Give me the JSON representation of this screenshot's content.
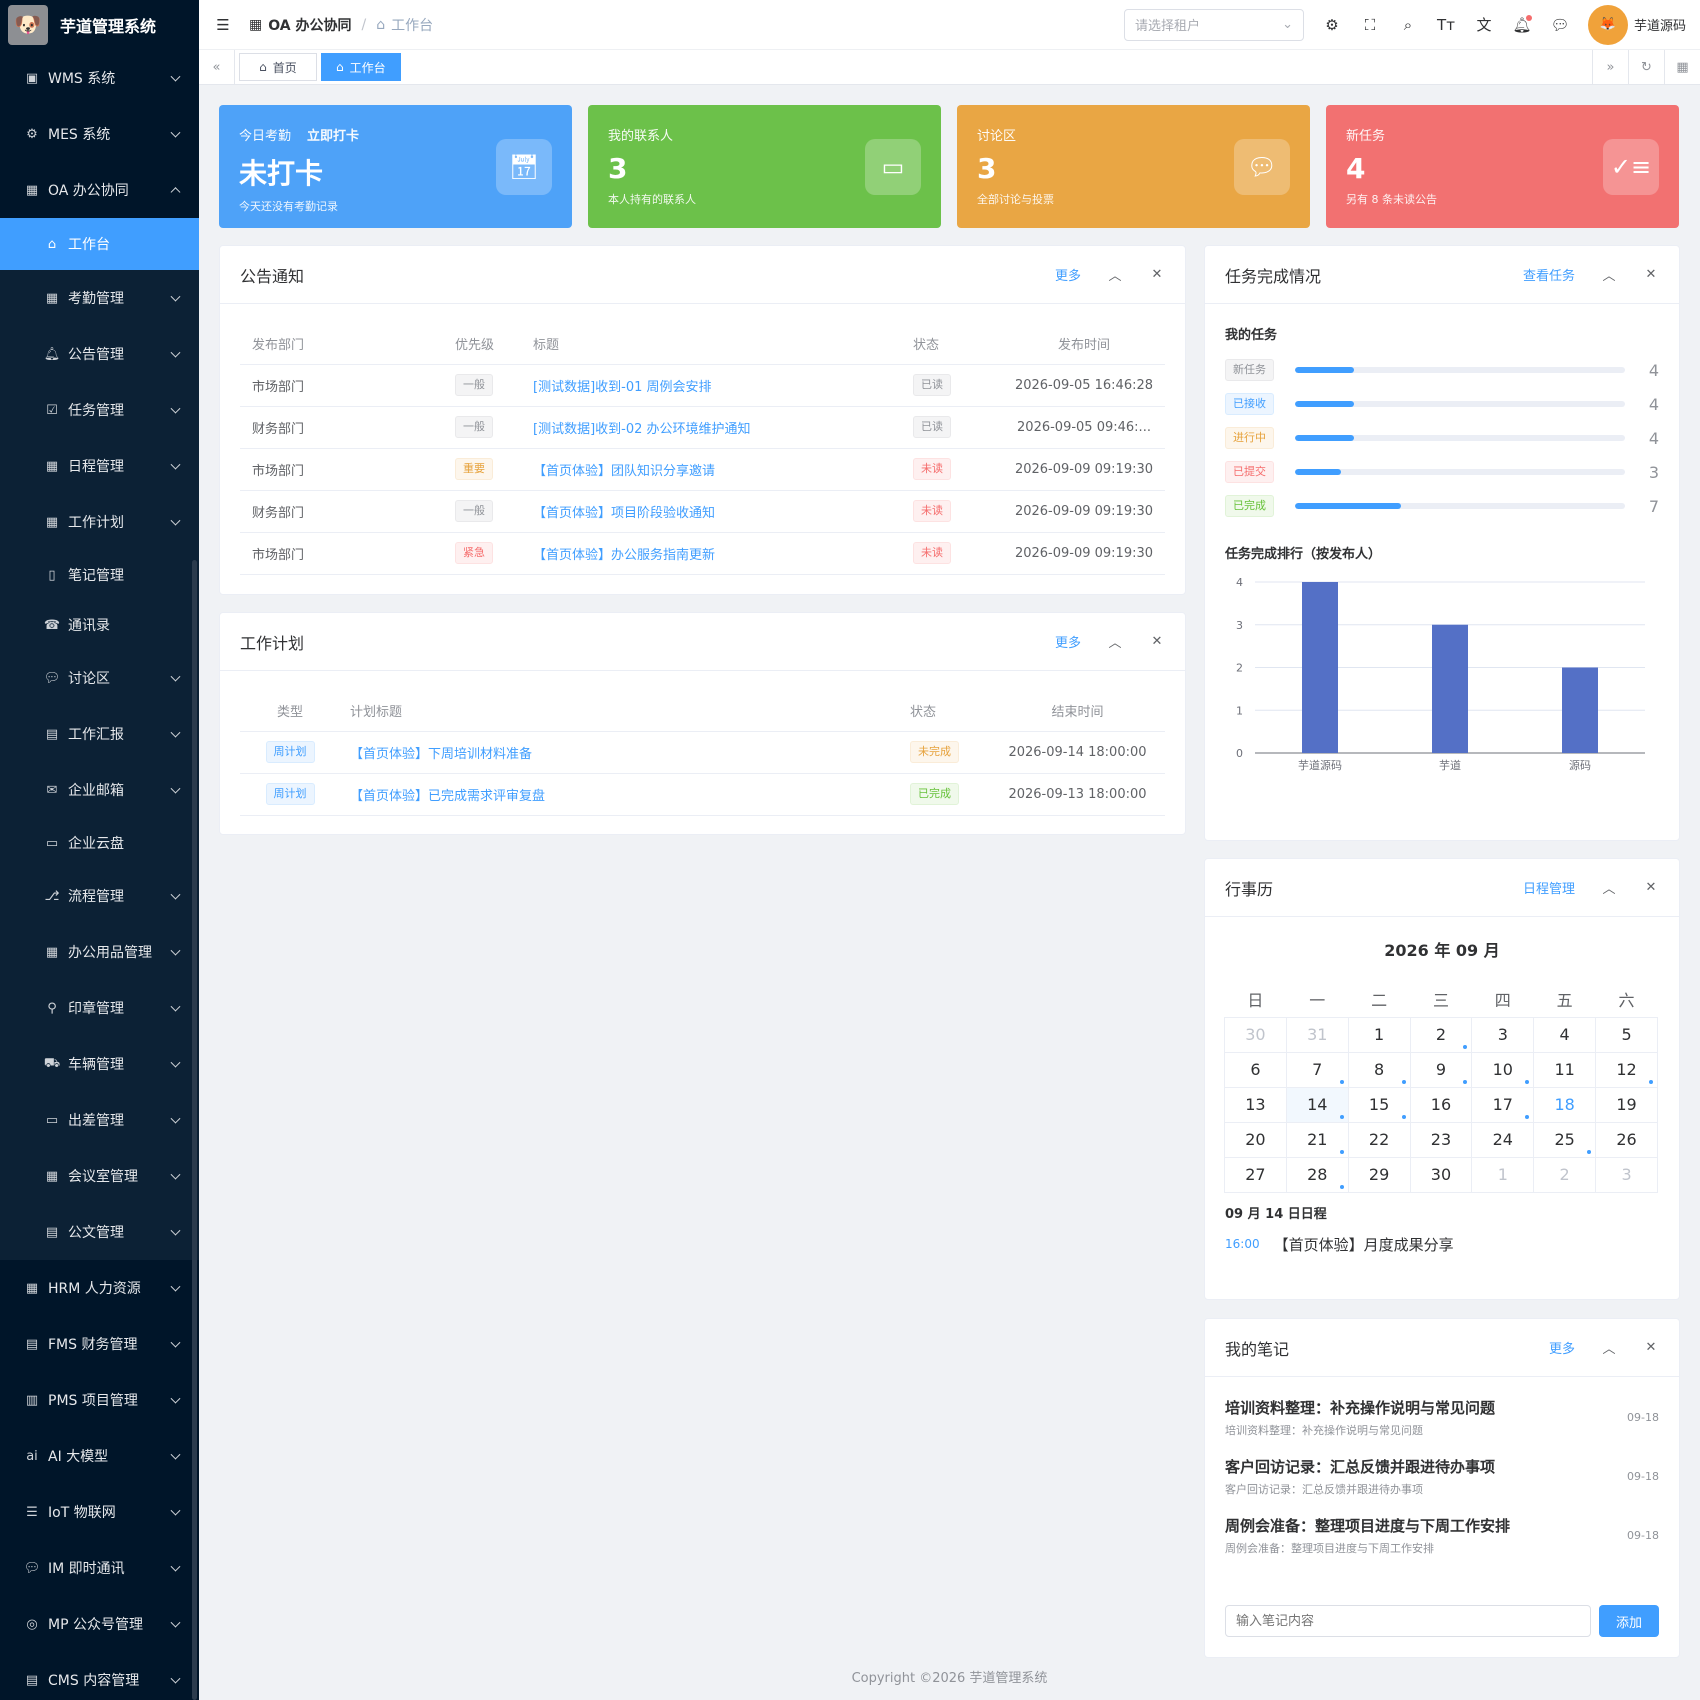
{
  "app": {
    "title": "芋道管理系统",
    "logo": "dog"
  },
  "sidebar": {
    "top": [
      {
        "label": "WMS 系统",
        "icon": "box-icon"
      },
      {
        "label": "MES 系统",
        "icon": "gear-icon"
      },
      {
        "label": "OA 办公协同",
        "icon": "building-icon"
      }
    ],
    "oa_sub": [
      {
        "label": "工作台"
      },
      {
        "label": "考勤管理"
      },
      {
        "label": "公告管理"
      },
      {
        "label": "任务管理"
      },
      {
        "label": "日程管理"
      },
      {
        "label": "工作计划"
      },
      {
        "label": "笔记管理"
      },
      {
        "label": "通讯录"
      },
      {
        "label": "讨论区"
      },
      {
        "label": "工作汇报"
      },
      {
        "label": "企业邮箱"
      },
      {
        "label": "企业云盘"
      },
      {
        "label": "流程管理"
      },
      {
        "label": "办公用品管理"
      },
      {
        "label": "印章管理"
      },
      {
        "label": "车辆管理"
      },
      {
        "label": "出差管理"
      },
      {
        "label": "会议室管理"
      },
      {
        "label": "公文管理"
      }
    ],
    "bottom": [
      {
        "label": "HRM 人力资源"
      },
      {
        "label": "FMS 财务管理"
      },
      {
        "label": "PMS 项目管理"
      },
      {
        "label": "AI 大模型"
      },
      {
        "label": "IoT 物联网"
      },
      {
        "label": "IM 即时通讯"
      },
      {
        "label": "MP 公众号管理"
      },
      {
        "label": "CMS 内容管理"
      }
    ]
  },
  "header": {
    "crumb1": "OA 办公协同",
    "crumb2": "工作台",
    "tenant_placeholder": "请选择租户",
    "username": "芋道源码"
  },
  "tags": {
    "home": "首页",
    "workbench": "工作台"
  },
  "stats": [
    {
      "label": "今日考勤",
      "action": "立即打卡",
      "value": "未打卡",
      "desc": "今天还没有考勤记录",
      "color": "#4ea2f8"
    },
    {
      "label": "我的联系人",
      "value": "3",
      "desc": "本人持有的联系人",
      "color": "#6cc14a"
    },
    {
      "label": "讨论区",
      "value": "3",
      "desc": "全部讨论与投票",
      "color": "#e9a644"
    },
    {
      "label": "新任务",
      "value": "4",
      "desc": "另有 8 条未读公告",
      "color": "#f27171"
    }
  ],
  "notice": {
    "title": "公告通知",
    "more": "更多",
    "columns": [
      "发布部门",
      "优先级",
      "标题",
      "状态",
      "发布时间"
    ],
    "rows": [
      {
        "dept": "市场部门",
        "priority": "一般",
        "title": "[测试数据]收到-01 周例会安排",
        "status": "已读",
        "time": "2026-09-05 16:46:28"
      },
      {
        "dept": "财务部门",
        "priority": "一般",
        "title": "[测试数据]收到-02 办公环境维护通知",
        "status": "已读",
        "time": "2026-09-05 09:46:..."
      },
      {
        "dept": "市场部门",
        "priority": "重要",
        "title": "【首页体验】团队知识分享邀请",
        "status": "未读",
        "time": "2026-09-09 09:19:30"
      },
      {
        "dept": "财务部门",
        "priority": "一般",
        "title": "【首页体验】项目阶段验收通知",
        "status": "未读",
        "time": "2026-09-09 09:19:30"
      },
      {
        "dept": "市场部门",
        "priority": "紧急",
        "title": "【首页体验】办公服务指南更新",
        "status": "未读",
        "time": "2026-09-09 09:19:30"
      }
    ]
  },
  "plan": {
    "title": "工作计划",
    "more": "更多",
    "columns": [
      "类型",
      "计划标题",
      "状态",
      "结束时间"
    ],
    "rows": [
      {
        "type": "周计划",
        "title": "【首页体验】下周培训材料准备",
        "status": "未完成",
        "time": "2026-09-14 18:00:00"
      },
      {
        "type": "周计划",
        "title": "【首页体验】已完成需求评审复盘",
        "status": "已完成",
        "time": "2026-09-13 18:00:00"
      }
    ]
  },
  "tasks": {
    "title": "任务完成情况",
    "more": "查看任务",
    "my_tasks": "我的任务",
    "progress": [
      {
        "label": "新任务",
        "count": "4",
        "fraction": 0.18
      },
      {
        "label": "已接收",
        "count": "4",
        "fraction": 0.18
      },
      {
        "label": "进行中",
        "count": "4",
        "fraction": 0.18
      },
      {
        "label": "已提交",
        "count": "3",
        "fraction": 0.14
      },
      {
        "label": "已完成",
        "count": "7",
        "fraction": 0.32
      }
    ],
    "rank_title": "任务完成排行（按发布人）"
  },
  "chart_data": {
    "type": "bar",
    "categories": [
      "芋道源码",
      "芋道",
      "源码"
    ],
    "values": [
      4,
      3,
      2
    ],
    "ylim": [
      0,
      4
    ],
    "yticks": [
      0,
      1,
      2,
      3,
      4
    ],
    "color": "#5470c6",
    "grid": true
  },
  "calendar": {
    "title": "行事历",
    "more": "日程管理",
    "month_label": "2026 年 09 月",
    "weekdays": [
      "日",
      "一",
      "二",
      "三",
      "四",
      "五",
      "六"
    ],
    "weeks": [
      [
        {
          "d": "30",
          "o": true
        },
        {
          "d": "31",
          "o": true
        },
        {
          "d": "1"
        },
        {
          "d": "2",
          "e": true
        },
        {
          "d": "3"
        },
        {
          "d": "4"
        },
        {
          "d": "5"
        }
      ],
      [
        {
          "d": "6"
        },
        {
          "d": "7",
          "e": true
        },
        {
          "d": "8",
          "e": true
        },
        {
          "d": "9",
          "e": true
        },
        {
          "d": "10",
          "e": true
        },
        {
          "d": "11"
        },
        {
          "d": "12",
          "e": true
        }
      ],
      [
        {
          "d": "13"
        },
        {
          "d": "14",
          "e": true,
          "sel": true
        },
        {
          "d": "15",
          "e": true
        },
        {
          "d": "16"
        },
        {
          "d": "17",
          "e": true
        },
        {
          "d": "18",
          "today": true
        },
        {
          "d": "19"
        }
      ],
      [
        {
          "d": "20"
        },
        {
          "d": "21",
          "e": true
        },
        {
          "d": "22"
        },
        {
          "d": "23"
        },
        {
          "d": "24"
        },
        {
          "d": "25",
          "e": true
        },
        {
          "d": "26"
        }
      ],
      [
        {
          "d": "27"
        },
        {
          "d": "28",
          "e": true
        },
        {
          "d": "29"
        },
        {
          "d": "30"
        },
        {
          "d": "1",
          "o": true
        },
        {
          "d": "2",
          "o": true
        },
        {
          "d": "3",
          "o": true
        }
      ]
    ],
    "day_title": "09 月 14 日日程",
    "event_time": "16:00",
    "event_title": "【首页体验】月度成果分享"
  },
  "notes": {
    "title": "我的笔记",
    "more": "更多",
    "items": [
      {
        "title": "培训资料整理：补充操作说明与常见问题",
        "desc": "培训资料整理：补充操作说明与常见问题",
        "date": "09-18"
      },
      {
        "title": "客户回访记录：汇总反馈并跟进待办事项",
        "desc": "客户回访记录：汇总反馈并跟进待办事项",
        "date": "09-18"
      },
      {
        "title": "周例会准备：整理项目进度与下周工作安排",
        "desc": "周例会准备：整理项目进度与下周工作安排",
        "date": "09-18"
      }
    ],
    "input_placeholder": "输入笔记内容",
    "add": "添加"
  },
  "footer": "Copyright ©2026 芋道管理系统"
}
